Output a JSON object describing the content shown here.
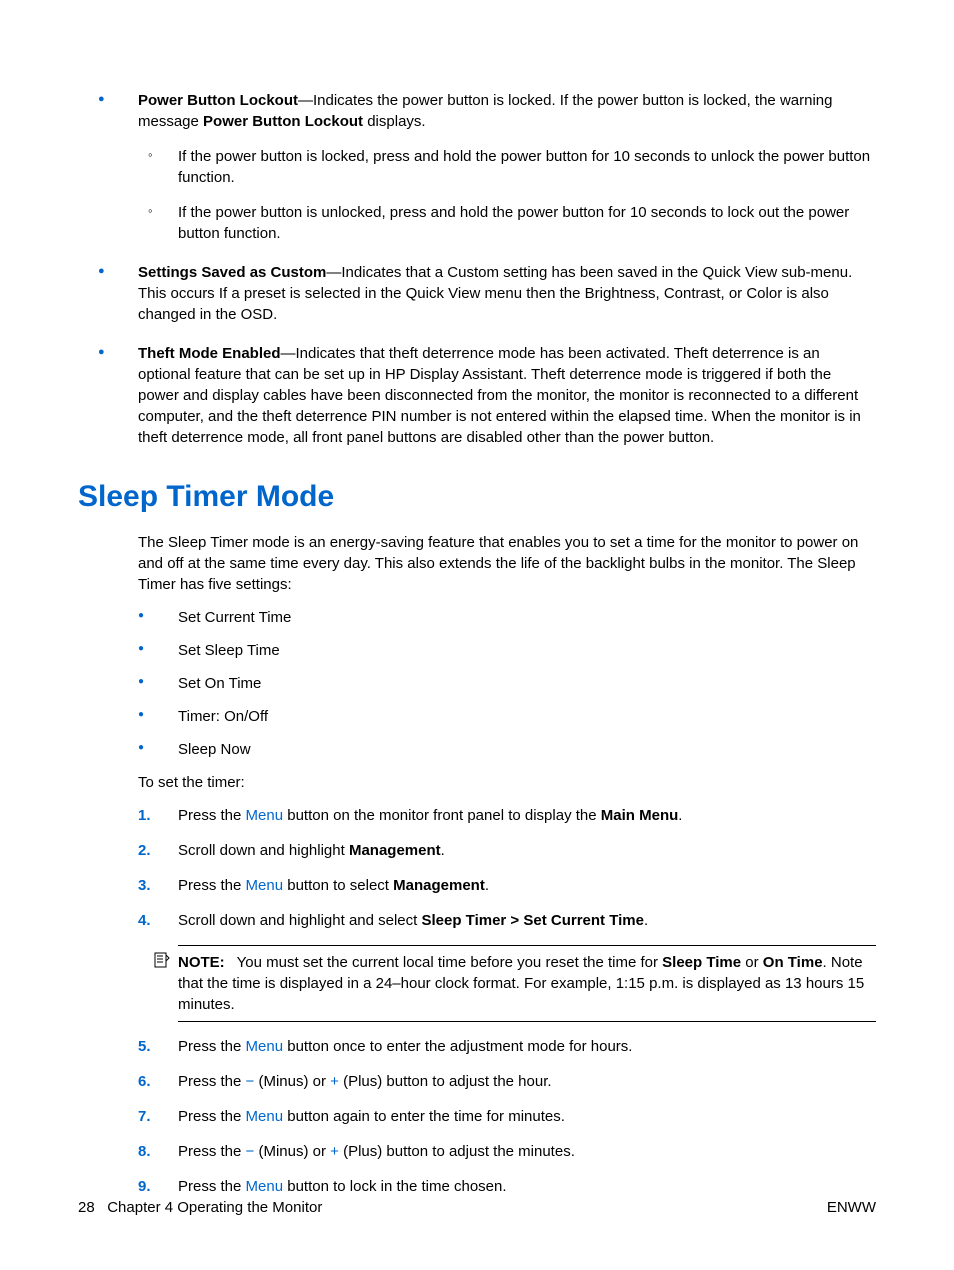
{
  "bullets": {
    "pbl_title": "Power Button Lockout",
    "pbl_text": "—Indicates the power button is locked. If the power button is locked, the warning message ",
    "pbl_bold2": "Power Button Lockout",
    "pbl_tail": " displays.",
    "pbl_sub1": "If the power button is locked, press and hold the power button for 10 seconds to unlock the power button function.",
    "pbl_sub2": "If the power button is unlocked, press and hold the power button for 10 seconds to lock out the power button function.",
    "ssc_title": "Settings Saved as Custom",
    "ssc_text": "—Indicates that a Custom setting has been saved in the Quick View sub-menu. This occurs If a preset is selected in the Quick View menu then the Brightness, Contrast, or Color is also changed in the OSD.",
    "tme_title": "Theft Mode Enabled",
    "tme_text": "—Indicates that theft deterrence mode has been activated. Theft deterrence is an optional feature that can be set up in HP Display Assistant. Theft deterrence mode is triggered if both the power and display cables have been disconnected from the monitor, the monitor is reconnected to a different computer, and the theft deterrence PIN number is not entered within the elapsed time. When the monitor is in theft deterrence mode, all front panel buttons are disabled other than the power button."
  },
  "section_title": "Sleep Timer Mode",
  "sleep_intro": "The Sleep Timer mode is an energy-saving feature that enables you to set a time for the monitor to power on and off at the same time every day. This also extends the life of the backlight bulbs in the monitor. The Sleep Timer has five settings:",
  "settings": [
    "Set Current Time",
    "Set Sleep Time",
    "Set On Time",
    "Timer: On/Off",
    "Sleep Now"
  ],
  "to_set": "To set the timer:",
  "steps": {
    "n1": "1.",
    "n2": "2.",
    "n3": "3.",
    "n4": "4.",
    "n5": "5.",
    "n6": "6.",
    "n7": "7.",
    "n8": "8.",
    "n9": "9.",
    "s1a": "Press the ",
    "s1_menu": "Menu",
    "s1b": " button on the monitor front panel to display the ",
    "s1_bold": "Main Menu",
    "s1c": ".",
    "s2a": "Scroll down and highlight ",
    "s2_bold": "Management",
    "s2b": ".",
    "s3a": "Press the ",
    "s3_menu": "Menu",
    "s3b": " button to select ",
    "s3_bold": "Management",
    "s3c": ".",
    "s4a": "Scroll down and highlight and select ",
    "s4_bold": "Sleep Timer > Set Current Time",
    "s4b": ".",
    "s5a": "Press the ",
    "s5_menu": "Menu",
    "s5b": " button once to enter the adjustment mode for hours.",
    "s6a": "Press the ",
    "s6_minus": "−",
    "s6b": " (Minus) or ",
    "s6_plus": "+",
    "s6c": " (Plus) button to adjust the hour.",
    "s7a": "Press the ",
    "s7_menu": "Menu",
    "s7b": " button again to enter the time for minutes.",
    "s8a": "Press the ",
    "s8_minus": "−",
    "s8b": " (Minus) or ",
    "s8_plus": "+",
    "s8c": " (Plus) button to adjust the minutes.",
    "s9a": "Press the ",
    "s9_menu": "Menu",
    "s9b": " button to lock in the time chosen."
  },
  "note": {
    "label": "NOTE:",
    "t1": "You must set the current local time before you reset the time for ",
    "b1": "Sleep Time",
    "t2": " or ",
    "b2": "On Time",
    "t3": ". Note that the time is displayed in a 24–hour clock format. For example, 1:15 p.m. is displayed as 13 hours 15 minutes."
  },
  "footer": {
    "page": "28",
    "chapter": "Chapter 4   Operating the Monitor",
    "right": "ENWW"
  }
}
